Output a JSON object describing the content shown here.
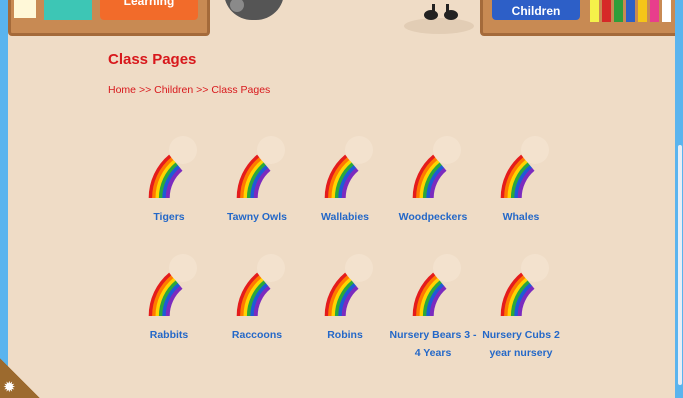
{
  "header": {
    "learning_label": "Learning",
    "children_label": "Children",
    "book_colors": [
      "#f5f14a",
      "#d62828",
      "#2e9e3a",
      "#2d5fc7",
      "#f5c518",
      "#e83e8c",
      "#ffffff"
    ]
  },
  "page": {
    "title": "Class Pages",
    "breadcrumb": [
      "Home",
      ">>",
      "Children",
      ">>",
      "Class Pages"
    ]
  },
  "classes": [
    {
      "name": "Tigers"
    },
    {
      "name": "Tawny Owls"
    },
    {
      "name": "Wallabies"
    },
    {
      "name": "Woodpeckers"
    },
    {
      "name": "Whales"
    },
    {
      "name": "Rabbits"
    },
    {
      "name": "Raccoons"
    },
    {
      "name": "Robins"
    },
    {
      "name": "Nursery Bears 3 - 4 Years"
    },
    {
      "name": "Nursery Cubs 2 year nursery"
    }
  ],
  "icons": {
    "class_icon": "rainbow-icon",
    "corner": "gear-icon"
  },
  "colors": {
    "background": "#efdcc6",
    "title": "#d8181c",
    "link": "#2468c8",
    "rainbow": [
      "#e41c1c",
      "#ff7a00",
      "#ffd400",
      "#2aa83c",
      "#1e5bd6",
      "#7b2bbf"
    ]
  }
}
